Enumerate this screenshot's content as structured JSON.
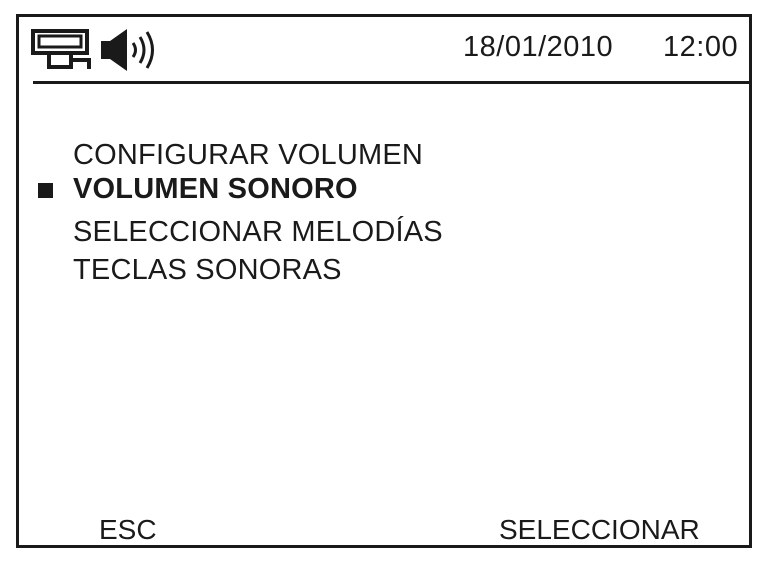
{
  "status_bar": {
    "icons": [
      "network-icon",
      "speaker-icon"
    ],
    "date": "18/01/2010",
    "time": "12:00"
  },
  "menu": {
    "items": [
      {
        "label": "CONFIGURAR VOLUMEN",
        "selected": false
      },
      {
        "label": "VOLUMEN SONORO",
        "selected": true
      },
      {
        "label": "SELECCIONAR MELODÍAS",
        "selected": false
      },
      {
        "label": "TECLAS SONORAS",
        "selected": false
      }
    ]
  },
  "softkeys": {
    "left": "ESC",
    "right_prefix": "SE",
    "right_underlined": "LECCION",
    "right_suffix": "AR"
  },
  "colors": {
    "foreground": "#1a1a1a",
    "background": "#ffffff"
  }
}
